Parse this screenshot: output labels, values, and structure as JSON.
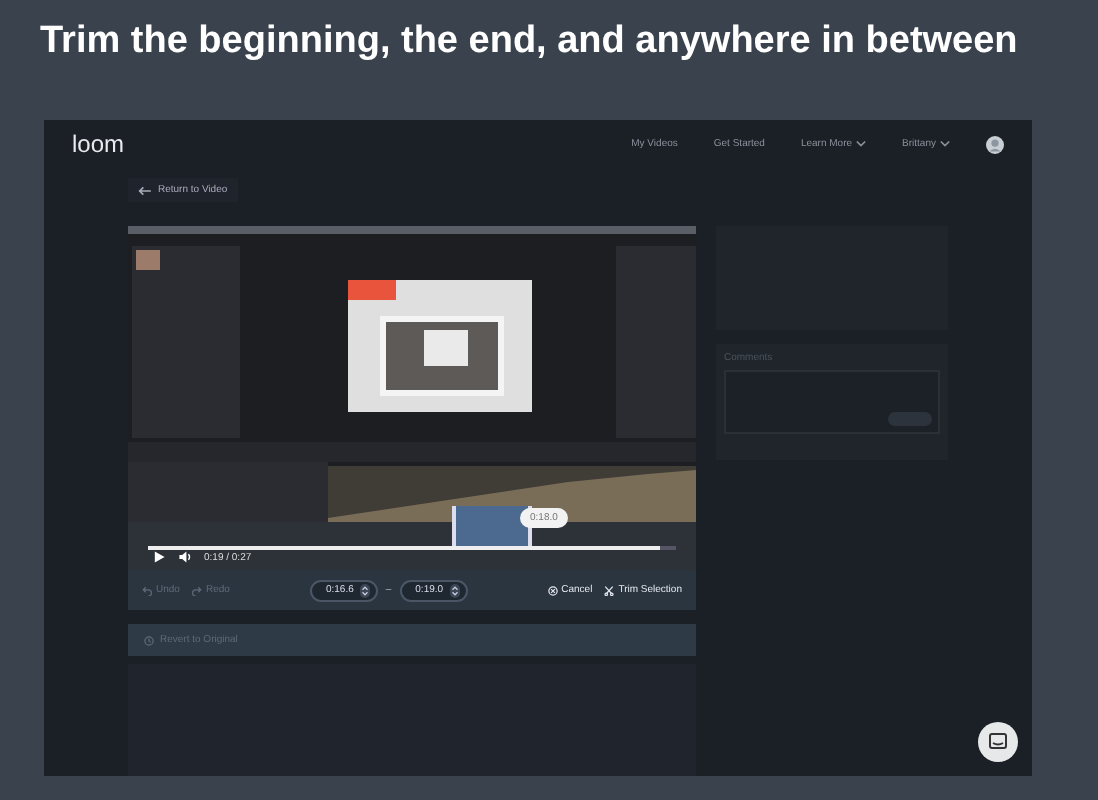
{
  "headline": "Trim the beginning, the end, and anywhere in between",
  "app": {
    "logo": "loom",
    "nav": [
      {
        "label": "My Videos",
        "dropdown": false
      },
      {
        "label": "Get Started",
        "dropdown": false
      },
      {
        "label": "Learn More",
        "dropdown": true
      },
      {
        "label": "Brittany",
        "dropdown": true
      }
    ],
    "back_button": "Return to Video",
    "player": {
      "trim_label": "0:18.0",
      "time": "0:19 / 0:27",
      "level": 0.97
    },
    "editor": {
      "undo": {
        "label": "Undo",
        "disabled": true
      },
      "redo": {
        "label": "Redo",
        "disabled": true
      },
      "start": "0:16.6",
      "separator": "–",
      "end": "0:19.0",
      "cancel": "Cancel",
      "trim": "Trim Selection"
    },
    "revert": {
      "label": "Revert to Original",
      "disabled": true
    },
    "comments": {
      "title": "Comments"
    }
  }
}
